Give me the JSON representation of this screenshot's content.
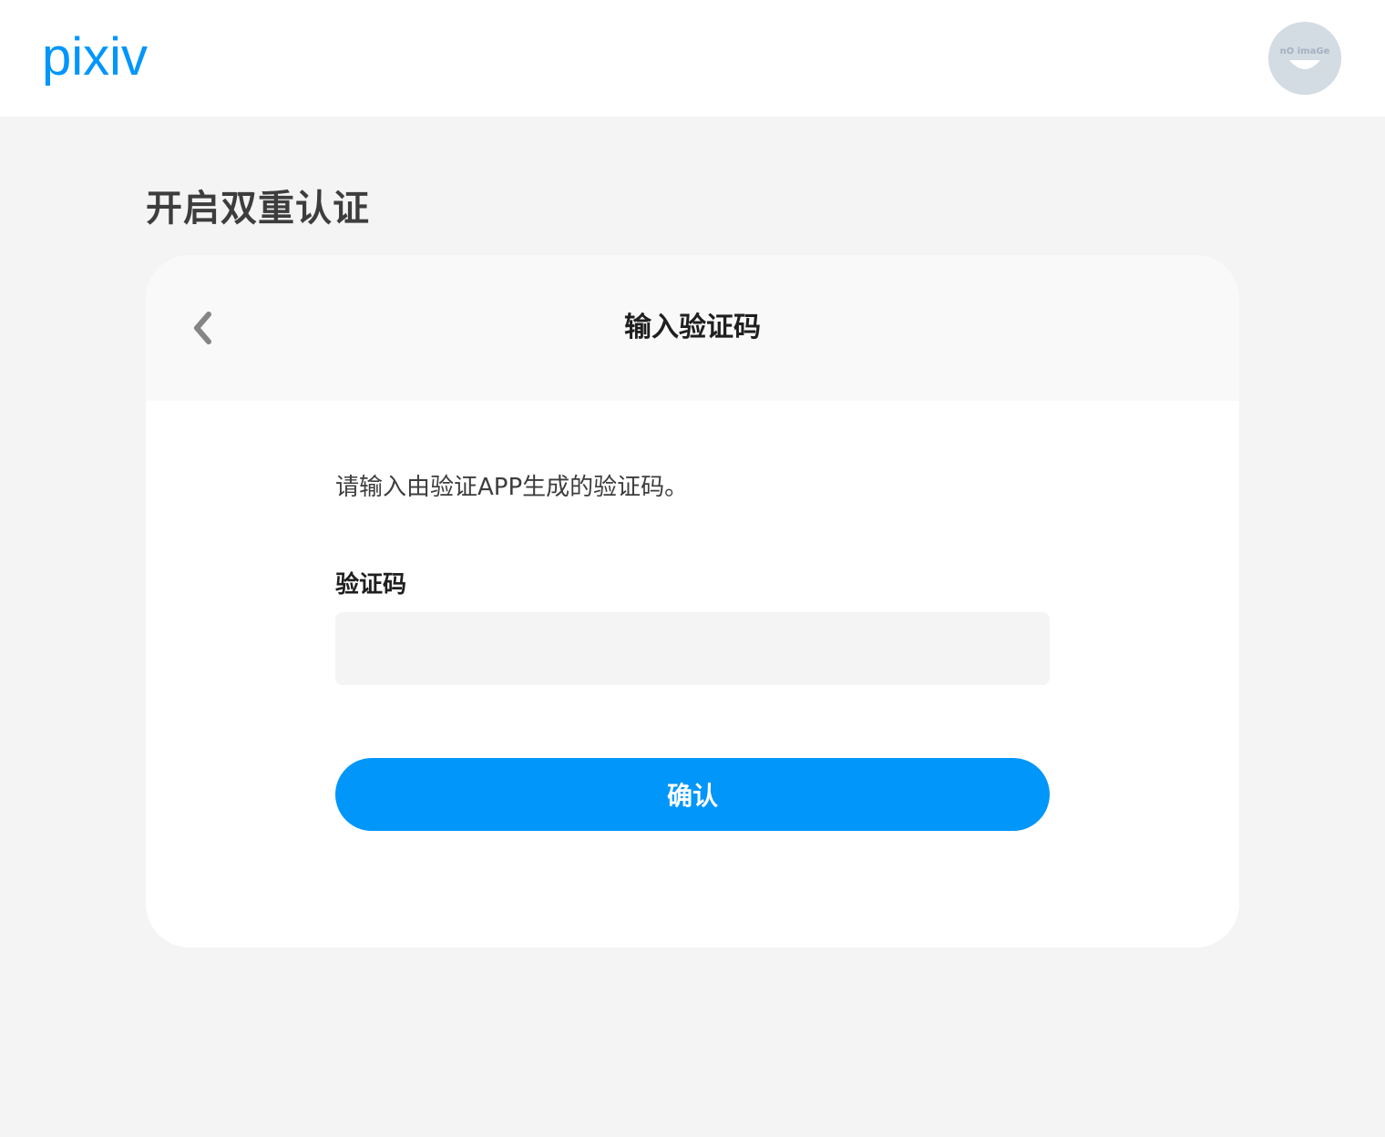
{
  "header": {
    "logo_text": "pixiv",
    "avatar_icon": "no-image-avatar-icon",
    "avatar_text": "nO imaGe"
  },
  "page": {
    "title": "开启双重认证"
  },
  "card": {
    "back_icon": "chevron-left-icon",
    "title": "输入验证码",
    "instructions": "请输入由验证APP生成的验证码。",
    "code_label": "验证码",
    "code_value": "",
    "code_placeholder": "",
    "confirm_label": "确认"
  },
  "colors": {
    "brand": "#0096fa",
    "page_background": "#f4f4f4",
    "card_header_background": "#f9f9f9",
    "input_background": "#f4f4f4",
    "text_primary": "#1f1f1f",
    "text_secondary": "#3d3d3d"
  }
}
